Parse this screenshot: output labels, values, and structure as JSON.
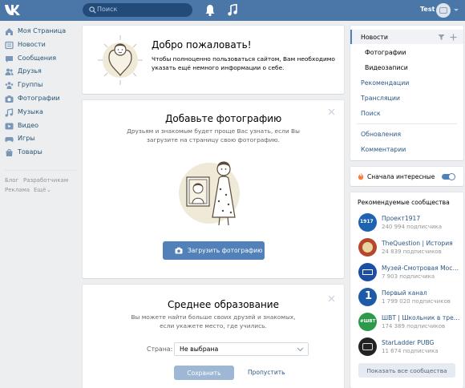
{
  "header": {
    "search_placeholder": "Поиск",
    "user_name": "Test"
  },
  "left_nav": {
    "items": [
      {
        "label": "Моя Страница",
        "icon": "home-icon"
      },
      {
        "label": "Новости",
        "icon": "news-icon"
      },
      {
        "label": "Сообщения",
        "icon": "messages-icon"
      },
      {
        "label": "Друзья",
        "icon": "friends-icon"
      },
      {
        "label": "Группы",
        "icon": "groups-icon"
      },
      {
        "label": "Фотографии",
        "icon": "photos-icon"
      },
      {
        "label": "Музыка",
        "icon": "music-icon"
      },
      {
        "label": "Видео",
        "icon": "video-icon"
      },
      {
        "label": "Игры",
        "icon": "games-icon"
      },
      {
        "label": "Товары",
        "icon": "market-icon"
      }
    ],
    "footer_links": [
      "Блог",
      "Разработчикам",
      "Реклама",
      "Ещё"
    ]
  },
  "welcome_card": {
    "title": "Добро пожаловать!",
    "text": "Чтобы полноценно пользоваться сайтом, Вам необходимо указать ещё немного информации о себе."
  },
  "photo_card": {
    "title": "Добавьте фотографию",
    "text": "Друзьям и знакомым будет проще Вас узнать, если Вы загрузите на страницу свою фотографию.",
    "button": "Загрузить фотографию"
  },
  "education_card": {
    "title": "Среднее образование",
    "text": "Вы можете найти больше своих друзей и знакомых, если укажете место, где учились.",
    "country_label": "Страна:",
    "country_value": "Не выбрана",
    "save_button": "Сохранить",
    "skip_link": "Пропустить"
  },
  "right_menu": {
    "items": [
      "Новости",
      "Фотографии",
      "Видеозаписи",
      "Рекомендации",
      "Трансляции",
      "Поиск",
      "Обновления",
      "Комментарии"
    ]
  },
  "interesting_toggle": {
    "label": "Сначала интересные",
    "enabled": true
  },
  "communities": {
    "title": "Рекомендуемые сообщества",
    "items": [
      {
        "name": "Проект1917",
        "subs": "240 994 подписчика",
        "color": "#1e63b0"
      },
      {
        "name": "TheQuestion | История",
        "subs": "24 839 подписчиков",
        "color": "#b5472a"
      },
      {
        "name": "Музей-Смотровая Моск...",
        "subs": "7 903 подписчика",
        "color": "#1c4fa3"
      },
      {
        "name": "Первый канал",
        "subs": "1 799 020 подписчиков",
        "color": "#1d5aa8"
      },
      {
        "name": "ШВТ | Школьник в тренде",
        "subs": "174 389 подписчиков",
        "color": "#2c9a4a"
      },
      {
        "name": "StarLadder PUBG",
        "subs": "11 674 подписчика",
        "color": "#222222"
      }
    ],
    "show_all": "Показать все сообщества"
  },
  "colors": {
    "header_bg": "#4a76a8",
    "link": "#2a5885",
    "button": "#5181b8",
    "page_bg": "#edeef0"
  }
}
